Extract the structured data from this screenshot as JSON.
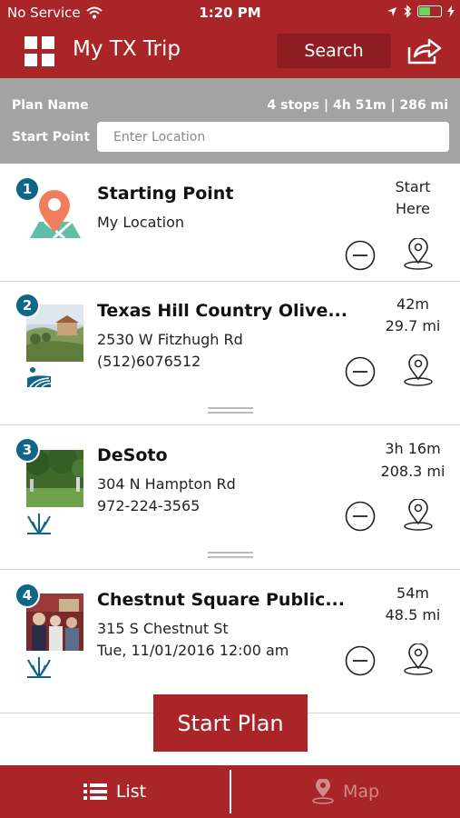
{
  "status_bar": {
    "carrier": "No Service",
    "time": "1:20 PM",
    "battery_level": 0.55,
    "battery_color": "#6fd45c"
  },
  "nav": {
    "title": "My TX Trip",
    "search_label": "Search",
    "menu_icon": "grid-icon",
    "share_icon": "share-icon"
  },
  "plan": {
    "name_label": "Plan Name",
    "summary": "4 stops | 4h 51m | 286 mi",
    "start_point_label": "Start Point",
    "location_placeholder": "Enter Location"
  },
  "stops": [
    {
      "number": "1",
      "name": "Starting Point",
      "line1": "My Location",
      "line2": "",
      "time": "Start",
      "distance": "Here",
      "icon": "map-location-icon"
    },
    {
      "number": "2",
      "name": "Texas Hill Country Olive...",
      "line1": "2530 W Fitzhugh Rd",
      "line2": "(512)6076512",
      "time": "42m",
      "distance": "29.7 mi",
      "category_icon": "farm-field-icon"
    },
    {
      "number": "3",
      "name": "DeSoto",
      "line1": "304 N Hampton Rd",
      "line2": "972-224-3565",
      "time": "3h 16m",
      "distance": "208.3 mi",
      "category_icon": "reeds-icon"
    },
    {
      "number": "4",
      "name": "Chestnut Square Public...",
      "line1": "315 S Chestnut St",
      "line2": "Tue, 11/01/2016 12:00 am",
      "time": "54m",
      "distance": "48.5 mi",
      "category_icon": "reeds-icon"
    }
  ],
  "start_plan_label": "Start Plan",
  "tabs": {
    "list_label": "List",
    "map_label": "Map"
  },
  "colors": {
    "brand_red": "#a92528",
    "stop_number_blue": "#0f6689",
    "header_gray": "#a3a3a3"
  }
}
